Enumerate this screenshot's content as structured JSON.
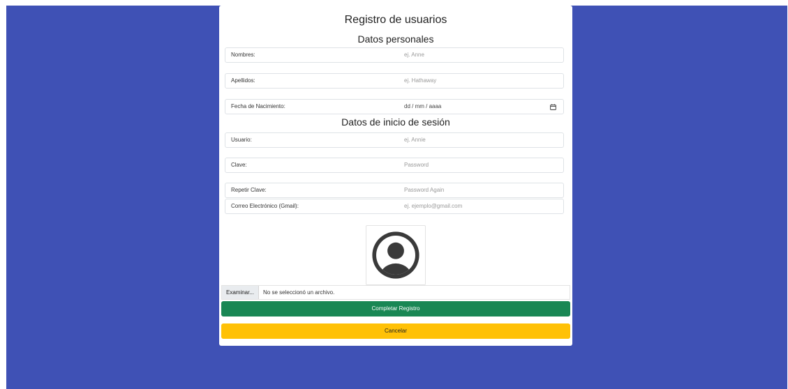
{
  "page": {
    "title": "Registro de usuarios"
  },
  "sections": {
    "personal": "Datos personales",
    "login": "Datos de inicio de sesión"
  },
  "fields": {
    "nombres": {
      "label": "Nombres:",
      "placeholder": "ej. Anne"
    },
    "apellidos": {
      "label": "Apellidos:",
      "placeholder": "ej. Hathaway"
    },
    "fecha": {
      "label": "Fecha de Nacimiento:",
      "value": "dd / mm / aaaa",
      "icon": "calendar-icon"
    },
    "usuario": {
      "label": "Usuario:",
      "placeholder": "ej. Annie"
    },
    "clave": {
      "label": "Clave:",
      "placeholder": "Password"
    },
    "repetir": {
      "label": "Repetir Clave:",
      "placeholder": "Password Again"
    },
    "correo": {
      "label": "Correo Electrónico (Gmail):",
      "placeholder": "ej. ejemplo@gmail.com"
    }
  },
  "avatar": {
    "icon": "user-avatar-icon"
  },
  "file": {
    "button_label": "Examinar...",
    "status": "No se seleccionó un archivo."
  },
  "buttons": {
    "submit": "Completar Registro",
    "cancel": "Cancelar"
  },
  "colors": {
    "background": "#3f51b5",
    "success": "#198754",
    "warning": "#ffc107"
  }
}
